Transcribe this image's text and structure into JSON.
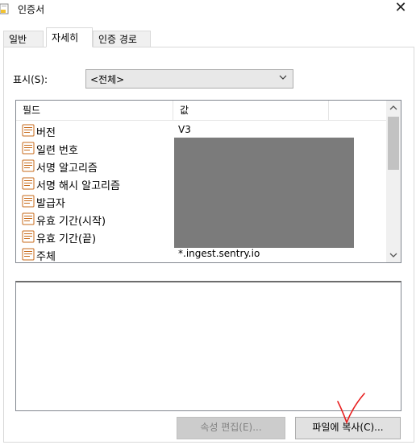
{
  "window": {
    "title": "인증서",
    "close_glyph": "✕"
  },
  "tabs": [
    {
      "label": "일반",
      "active": false
    },
    {
      "label": "자세히",
      "active": true
    },
    {
      "label": "인증 경로",
      "active": false
    }
  ],
  "show": {
    "label": "표시(S):",
    "selected": "<전체>"
  },
  "list": {
    "columns": {
      "field": "필드",
      "value": "값"
    },
    "rows": [
      {
        "field": "버전",
        "value": "V3"
      },
      {
        "field": "일련 번호",
        "value": ""
      },
      {
        "field": "서명 알고리즘",
        "value": ""
      },
      {
        "field": "서명 해시 알고리즘",
        "value": ""
      },
      {
        "field": "발급자",
        "value": ""
      },
      {
        "field": "유효 기간(시작)",
        "value": ""
      },
      {
        "field": "유효 기간(끝)",
        "value": ""
      },
      {
        "field": "주체",
        "value": "*.ingest.sentry.io"
      }
    ],
    "row_icon": "certificate-field-icon"
  },
  "buttons": {
    "edit_properties": "속성 편집(E)...",
    "copy_to_file": "파일에 복사(C)..."
  },
  "colors": {
    "annotation": "#e81f1f",
    "redaction": "#7b7b7b",
    "disabled_button": "#cccccc"
  }
}
